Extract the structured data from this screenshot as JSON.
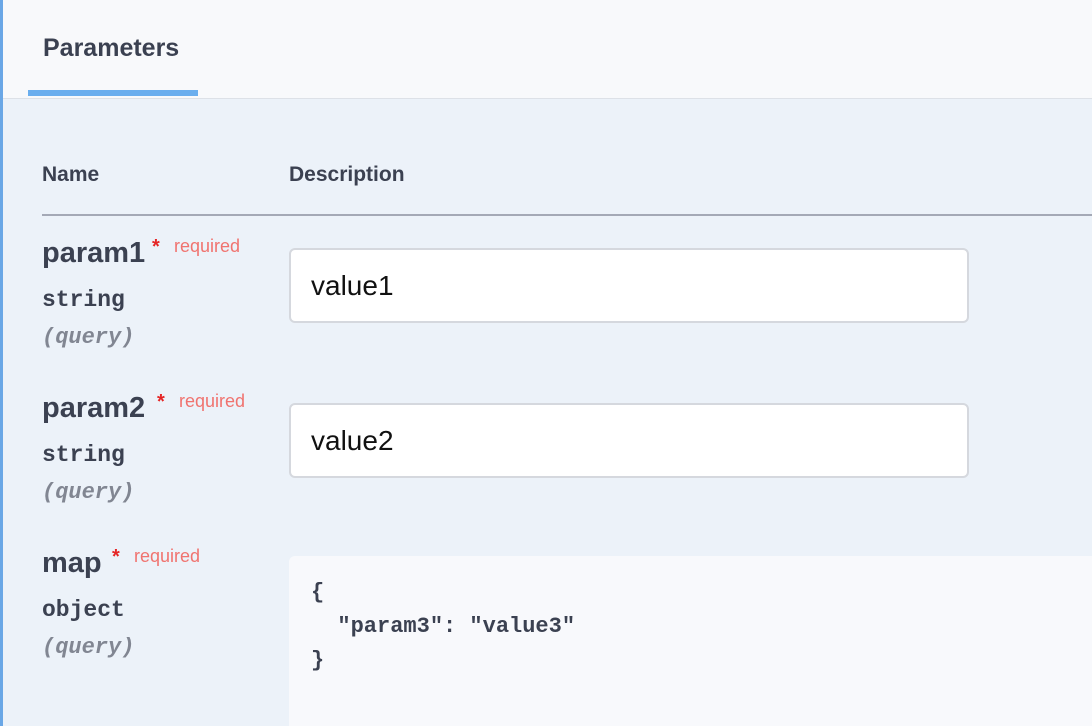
{
  "tabs": [
    {
      "label": "Parameters",
      "active": true
    }
  ],
  "table": {
    "headers": {
      "name": "Name",
      "description": "Description"
    }
  },
  "params": [
    {
      "name": "param1",
      "required_mark": "*",
      "required_label": "required",
      "type": "string",
      "in": "(query)",
      "value": "value1"
    },
    {
      "name": "param2",
      "required_mark": "*",
      "required_label": "required",
      "type": "string",
      "in": "(query)",
      "value": "value2"
    },
    {
      "name": "map",
      "required_mark": "*",
      "required_label": "required",
      "type": "object",
      "in": "(query)",
      "value": "{\n  \"param3\": \"value3\"\n}"
    }
  ],
  "colors": {
    "accent": "#6aaeee",
    "required_star": "#e52525",
    "required_text": "#f0736f",
    "text": "#3b4151",
    "muted": "#818692"
  }
}
